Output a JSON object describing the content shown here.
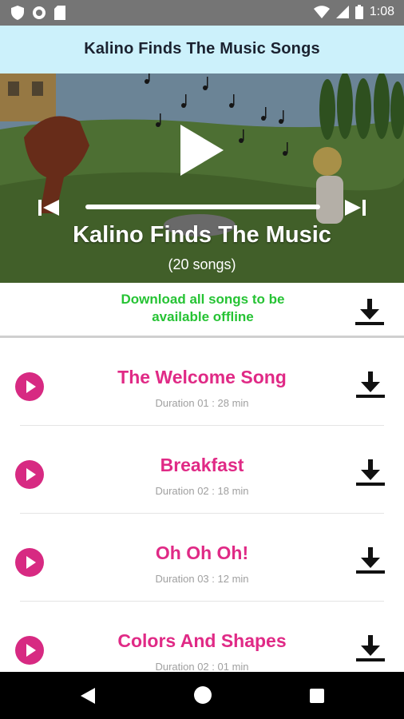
{
  "status_bar": {
    "time": "1:08",
    "icons": [
      "shield-icon",
      "circle-record-icon",
      "sd-card-icon",
      "wifi-icon",
      "signal-icon",
      "battery-icon"
    ]
  },
  "app_bar": {
    "title": "Kalino Finds The Music Songs"
  },
  "player": {
    "title": "Kalino Finds The Music",
    "song_count": "(20 songs)",
    "icons": [
      "play-icon",
      "skip-previous-icon",
      "skip-next-icon"
    ]
  },
  "download_all": {
    "text": "Download all songs to be available offline",
    "icon": "download-icon"
  },
  "songs": [
    {
      "title": "The Welcome Song",
      "duration": "Duration 01 : 28 min"
    },
    {
      "title": "Breakfast",
      "duration": "Duration 02 : 18 min"
    },
    {
      "title": "Oh Oh Oh!",
      "duration": "Duration 03 : 12 min"
    },
    {
      "title": "Colors And Shapes",
      "duration": "Duration 02 : 01 min"
    }
  ],
  "colors": {
    "app_bar_bg": "#ccf1fb",
    "accent_pink": "#e02a86",
    "download_green": "#26c334",
    "status_bar_bg": "#757575",
    "nav_bar_bg": "#000000"
  },
  "nav_bar": {
    "icons": [
      "back-icon",
      "home-icon",
      "recents-icon"
    ]
  }
}
